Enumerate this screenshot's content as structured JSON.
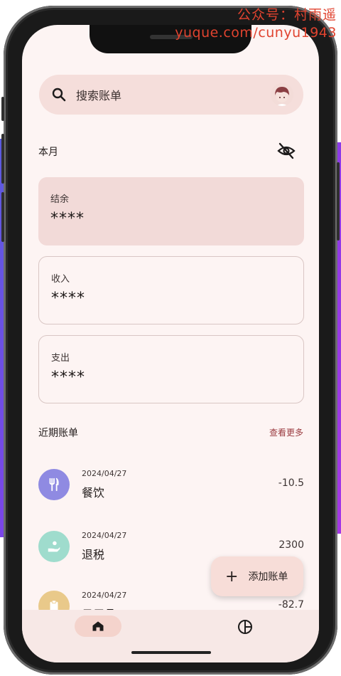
{
  "watermark": {
    "line1": "公众号：村雨遥",
    "line2": "yuque.com/cunyu1943"
  },
  "search": {
    "placeholder": "搜索账单"
  },
  "summary": {
    "period_label": "本月",
    "cards": [
      {
        "label": "结余",
        "value": "****"
      },
      {
        "label": "收入",
        "value": "****"
      },
      {
        "label": "支出",
        "value": "****"
      }
    ]
  },
  "recent": {
    "title": "近期账单",
    "more_label": "查看更多",
    "items": [
      {
        "date": "2024/04/27",
        "name": "餐饮",
        "amount": "-10.5",
        "icon": "fork-knife-icon",
        "color": "#8f8ae2"
      },
      {
        "date": "2024/04/27",
        "name": "退税",
        "amount": "2300",
        "icon": "hand-coin-icon",
        "color": "#9fdccd"
      },
      {
        "date": "2024/04/27",
        "name": "日用品",
        "amount": "-82.7",
        "icon": "clipboard-icon",
        "color": "#e9c98a"
      }
    ]
  },
  "fab": {
    "label": "添加账单"
  },
  "nav": {
    "items": [
      "home-icon",
      "pie-chart-icon"
    ]
  }
}
